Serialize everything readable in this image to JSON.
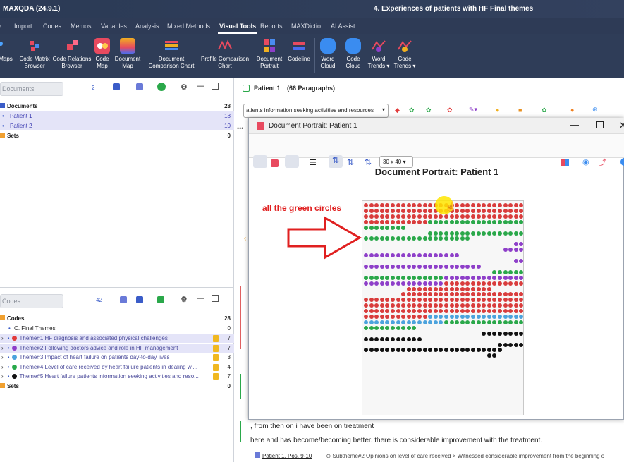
{
  "window": {
    "app_title": "MAXQDA (24.9.1)",
    "project_title": "4. Experiences of patients with HF Final themes"
  },
  "menu": [
    "Import",
    "Codes",
    "Memos",
    "Variables",
    "Analysis",
    "Mixed Methods",
    "Visual Tools",
    "Reports",
    "MAXDictio",
    "AI Assist"
  ],
  "menu_active": "Visual Tools",
  "ribbon": {
    "maps": "Maps",
    "code_matrix": [
      "Code Matrix",
      "Browser"
    ],
    "code_relations": [
      "Code Relations",
      "Browser"
    ],
    "code_map": [
      "Code",
      "Map"
    ],
    "document_map": [
      "Document",
      "Map"
    ],
    "doc_comparison": [
      "Document",
      "Comparison Chart"
    ],
    "profile_comparison": [
      "Profile Comparison",
      "Chart"
    ],
    "document_portrait": [
      "Document",
      "Portrait"
    ],
    "codeline": "Codeline",
    "word_cloud": [
      "Word",
      "Cloud"
    ],
    "code_cloud": [
      "Code",
      "Cloud"
    ],
    "word_trends": [
      "Word",
      "Trends ▾"
    ],
    "code_trends": [
      "Code",
      "Trends ▾"
    ]
  },
  "documents_panel": {
    "search_placeholder": "Documents",
    "toolbar_count": "2",
    "root": {
      "label": "Documents",
      "count": "28"
    },
    "items": [
      {
        "label": "Patient 1",
        "count": "18"
      },
      {
        "label": "Patient 2",
        "count": "10"
      }
    ],
    "sets": {
      "label": "Sets",
      "count": "0"
    }
  },
  "codes_panel": {
    "search_placeholder": "Codes",
    "toolbar_count": "42",
    "root": {
      "label": "Codes",
      "count": "28"
    },
    "group": {
      "label": "C. Final Themes",
      "count": "0"
    },
    "themes": [
      {
        "label": "Theme#1 HF diagnosis and associated physical challenges",
        "count": "7",
        "color": "#e23b3b"
      },
      {
        "label": "Theme#2 Following doctors advice and role in HF management",
        "count": "7",
        "color": "#8e3fc9"
      },
      {
        "label": "Theme#3 Impact of heart failure on patients day-to-day lives",
        "count": "3",
        "color": "#4ca3dd"
      },
      {
        "label": "Theme#4 Level of care received  by heart failure patients in  dealing wi...",
        "count": "4",
        "color": "#27a94a"
      },
      {
        "label": "Theme#5 Heart failure patients information seeking activities and reso...",
        "count": "7",
        "color": "#111111"
      }
    ],
    "sets": {
      "label": "Sets",
      "count": "0"
    }
  },
  "browser": {
    "doc_title": "Patient 1",
    "paragraphs": "(66 Paragraphs)",
    "code_dropdown": "atients information seeking activities and resources",
    "text_line1": ", from then on i have been on treatment",
    "text_line2": "here and has become/becoming better. there is considerable improvement with the treatment.",
    "status_link": "Patient 1, Pos. 9-10",
    "status_path": "Subtheme#2 Opinions on level of care received > Witnessed considerable improvement from the beginning o"
  },
  "portrait_window": {
    "title": "Document Portrait: Patient 1",
    "grid_size": "30 x 40",
    "heading": "Document Portrait: Patient 1"
  },
  "annotation": "all the green circles",
  "colors": {
    "red": "#d93c3c",
    "green": "#2aa84a",
    "purple": "#8e3fc9",
    "blue": "#4ca3dd",
    "black": "#111111"
  },
  "chart_data": {
    "type": "document-portrait-grid",
    "columns": 30,
    "rows": 40,
    "rows_data": [
      {
        "segments": [
          [
            "red",
            30
          ]
        ]
      },
      {
        "segments": [
          [
            "red",
            30
          ]
        ]
      },
      {
        "segments": [
          [
            "red",
            30
          ]
        ]
      },
      {
        "segments": [
          [
            "red",
            12
          ],
          [
            "green",
            18
          ]
        ]
      },
      {
        "segments": [
          [
            "green",
            8
          ]
        ]
      },
      {
        "segments": [
          [
            "empty",
            12
          ],
          [
            "green",
            18
          ]
        ]
      },
      {
        "segments": [
          [
            "green",
            20
          ]
        ]
      },
      {
        "segments": [
          [
            "empty",
            28
          ],
          [
            "purple",
            2
          ]
        ]
      },
      {
        "segments": [
          [
            "empty",
            26
          ],
          [
            "purple",
            4
          ]
        ]
      },
      {
        "segments": [
          [
            "purple",
            18
          ]
        ]
      },
      {
        "segments": [
          [
            "empty",
            28
          ],
          [
            "purple",
            2
          ]
        ]
      },
      {
        "segments": [
          [
            "purple",
            22
          ]
        ]
      },
      {
        "segments": [
          [
            "empty",
            24
          ],
          [
            "green",
            6
          ]
        ]
      },
      {
        "segments": [
          [
            "green",
            15
          ],
          [
            "purple",
            15
          ]
        ]
      },
      {
        "segments": [
          [
            "purple",
            15
          ],
          [
            "red",
            15
          ]
        ]
      },
      {
        "segments": [
          [
            "empty",
            8
          ],
          [
            "red",
            16
          ]
        ]
      },
      {
        "segments": [
          [
            "empty",
            7
          ],
          [
            "red",
            23
          ]
        ]
      },
      {
        "segments": [
          [
            "red",
            30
          ]
        ]
      },
      {
        "segments": [
          [
            "red",
            30
          ]
        ]
      },
      {
        "segments": [
          [
            "red",
            30
          ]
        ]
      },
      {
        "segments": [
          [
            "red",
            12
          ],
          [
            "blue",
            18
          ]
        ]
      },
      {
        "segments": [
          [
            "blue",
            15
          ],
          [
            "green",
            15
          ]
        ]
      },
      {
        "segments": [
          [
            "green",
            10
          ]
        ]
      },
      {
        "segments": [
          [
            "empty",
            22
          ],
          [
            "black",
            8
          ]
        ]
      },
      {
        "segments": [
          [
            "black",
            11
          ]
        ]
      },
      {
        "segments": [
          [
            "empty",
            25
          ],
          [
            "black",
            5
          ]
        ]
      },
      {
        "segments": [
          [
            "black",
            26
          ]
        ]
      },
      {
        "segments": [
          [
            "empty",
            23
          ],
          [
            "black",
            2
          ]
        ]
      }
    ]
  }
}
